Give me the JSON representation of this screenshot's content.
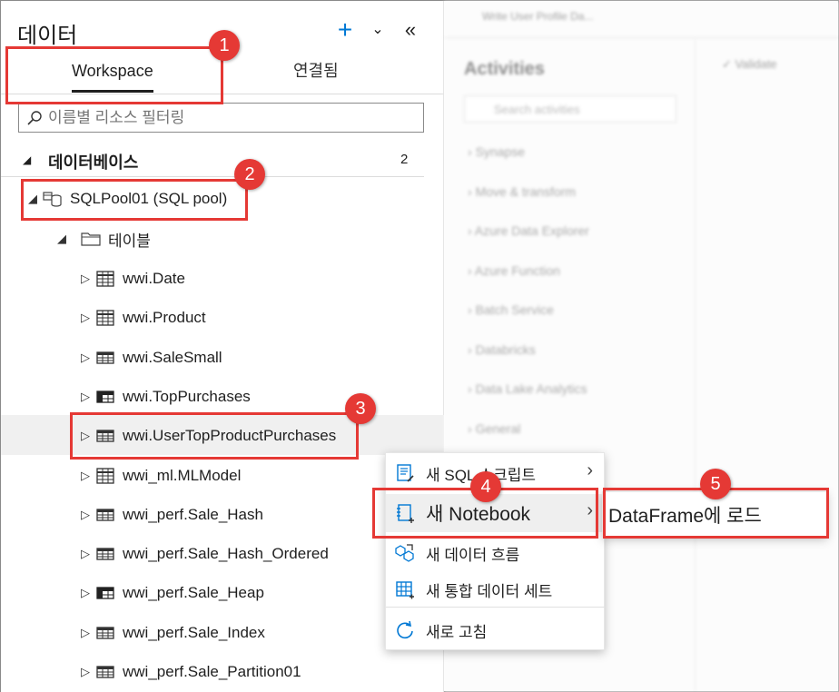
{
  "panel": {
    "title": "데이터",
    "tabs": {
      "workspace": "Workspace",
      "linked": "연결됨"
    },
    "search_placeholder": "이름별 리소스 필터링",
    "section": {
      "label": "데이터베이스",
      "count": "2"
    },
    "database": {
      "label": "SQLPool01 (SQL pool)"
    },
    "tables_folder": "테이블",
    "tables": [
      {
        "name": "wwi.Date",
        "icon": "table-grid-icon"
      },
      {
        "name": "wwi.Product",
        "icon": "table-grid-icon"
      },
      {
        "name": "wwi.SaleSmall",
        "icon": "table-icon"
      },
      {
        "name": "wwi.TopPurchases",
        "icon": "table-dark-icon"
      },
      {
        "name": "wwi.UserTopProductPurchases",
        "icon": "table-icon"
      },
      {
        "name": "wwi_ml.MLModel",
        "icon": "table-grid-icon"
      },
      {
        "name": "wwi_perf.Sale_Hash",
        "icon": "table-icon"
      },
      {
        "name": "wwi_perf.Sale_Hash_Ordered",
        "icon": "table-icon"
      },
      {
        "name": "wwi_perf.Sale_Heap",
        "icon": "table-dark-icon"
      },
      {
        "name": "wwi_perf.Sale_Index",
        "icon": "table-icon"
      },
      {
        "name": "wwi_perf.Sale_Partition01",
        "icon": "table-icon"
      }
    ]
  },
  "context_menu": {
    "items": [
      {
        "label": "새 SQL 스크립트",
        "icon": "sql-script-icon",
        "has_submenu": true
      },
      {
        "label": "새 Notebook",
        "icon": "notebook-icon",
        "has_submenu": true
      },
      {
        "label": "새 데이터 흐름",
        "icon": "dataflow-icon",
        "has_submenu": false
      },
      {
        "label": "새 통합 데이터 세트",
        "icon": "dataset-icon",
        "has_submenu": false
      },
      {
        "label": "새로 고침",
        "icon": "refresh-icon",
        "has_submenu": false
      }
    ],
    "submenu": {
      "label": "DataFrame에 로드"
    }
  },
  "background": {
    "tab_title": "Write User Profile Da...",
    "activities_title": "Activities",
    "activities_search": "Search activities",
    "activity_groups": [
      "Synapse",
      "Move & transform",
      "Azure Data Explorer",
      "Azure Function",
      "Batch Service",
      "Databricks",
      "Data Lake Analytics",
      "General"
    ],
    "validate": "Validate"
  },
  "callouts": [
    "1",
    "2",
    "3",
    "4",
    "5"
  ],
  "colors": {
    "accent": "#0078d4",
    "callout": "#e53935",
    "highlight": "#f0f0f0"
  }
}
